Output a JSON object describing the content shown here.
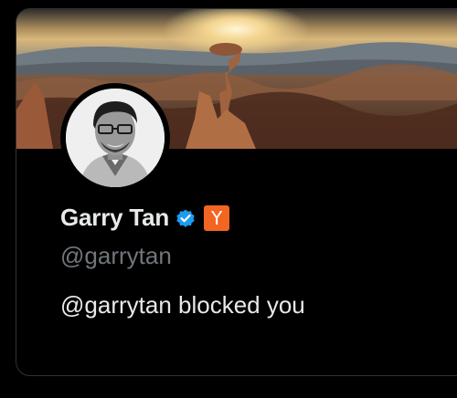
{
  "profile": {
    "display_name": "Garry Tan",
    "handle": "@garrytan",
    "badge_label": "Y",
    "verified": true
  },
  "message": {
    "text": "@garrytan blocked you"
  },
  "colors": {
    "background": "#000000",
    "verified_blue": "#1d9bf0",
    "yc_orange": "#f26522",
    "primary_text": "#e7e9ea",
    "secondary_text": "#71767b"
  },
  "icons": {
    "verified": "verified-badge-icon",
    "affiliate": "y-combinator-badge"
  }
}
